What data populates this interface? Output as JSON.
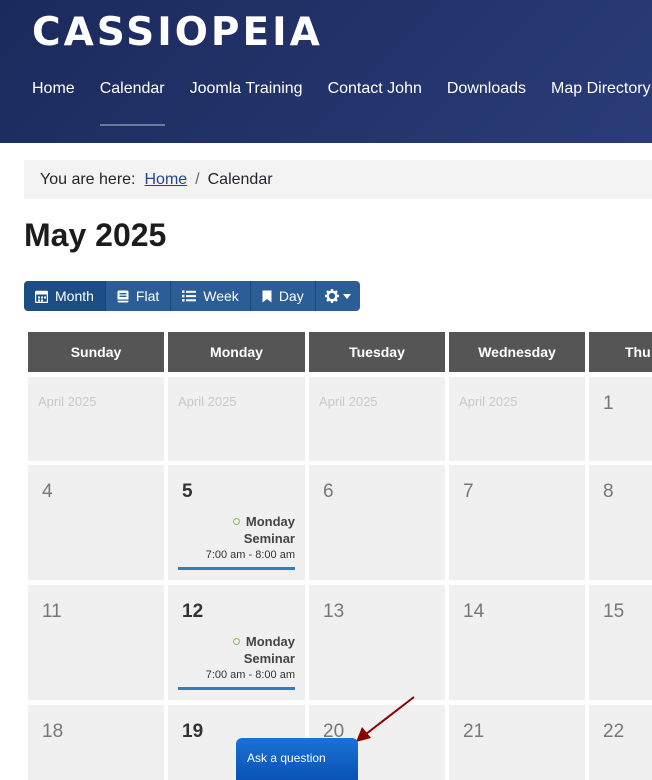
{
  "site": {
    "brand": "CASSIOPEIA"
  },
  "nav": [
    "Home",
    "Calendar",
    "Joomla Training",
    "Contact John",
    "Downloads",
    "Map Directory"
  ],
  "breadcrumb": {
    "prefix": "You are here:",
    "home": "Home",
    "separator": "/",
    "current": "Calendar"
  },
  "page": {
    "title": "May 2025"
  },
  "views": {
    "month": "Month",
    "flat": "Flat",
    "week": "Week",
    "day": "Day"
  },
  "calendar": {
    "weekdays": [
      "Sunday",
      "Monday",
      "Tuesday",
      "Wednesday",
      "Thu"
    ],
    "prev_month_label": "April 2025",
    "rows": [
      [
        "",
        "",
        "",
        "",
        "1"
      ],
      [
        "4",
        "5",
        "6",
        "7",
        "8"
      ],
      [
        "11",
        "12",
        "13",
        "14",
        "15"
      ],
      [
        "18",
        "19",
        "20",
        "21",
        "22"
      ]
    ],
    "events": [
      {
        "title": "Monday Seminar",
        "time": "7:00 am - 8:00 am"
      },
      {
        "title": "Monday Seminar",
        "time": "7:00 am - 8:00 am"
      }
    ]
  },
  "chat": {
    "label": "Ask a question"
  },
  "colors": {
    "header": "#1b2a5c",
    "button": "#2b5e97",
    "weekday_header": "#555555",
    "event_bar": "#2d7fc1",
    "arrow": "#8b0000"
  }
}
